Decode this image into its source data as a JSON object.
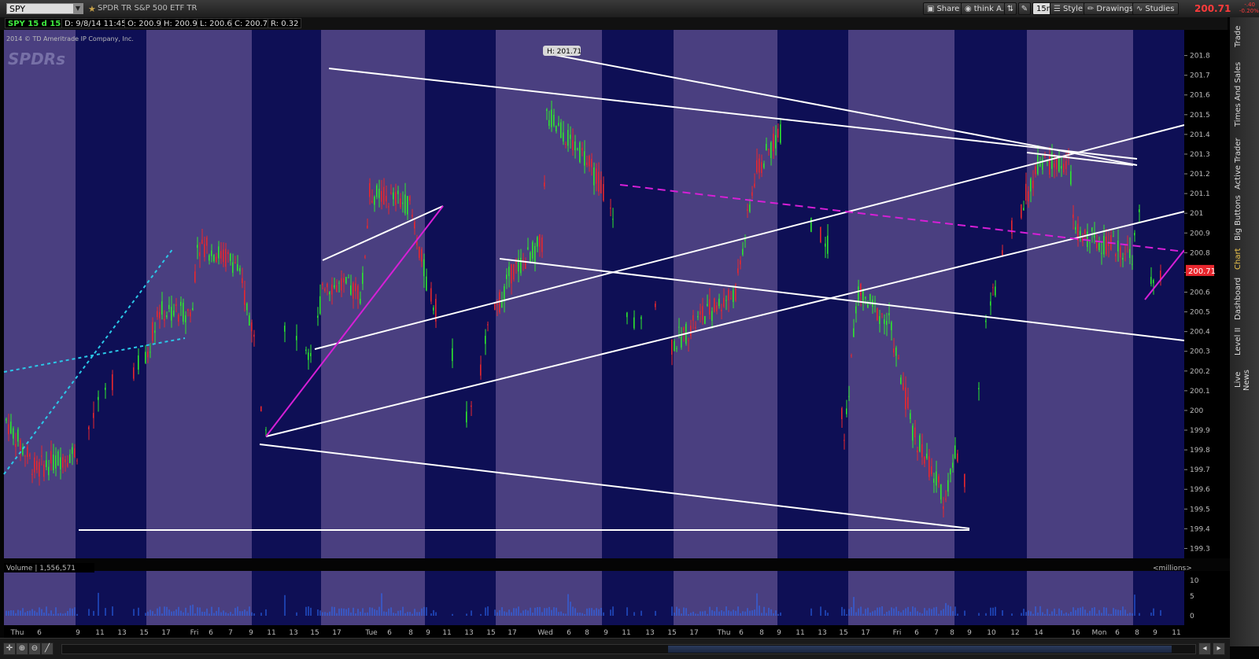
{
  "toolbar": {
    "symbol": "SPY",
    "description": "SPDR TR S&P 500 ETF TR",
    "buttons": [
      "Share",
      "think A.I.",
      "15m",
      "Style",
      "Drawings",
      "Studies"
    ],
    "last_price": "200.71",
    "change_top": "-.40",
    "change_bottom": "-0.20%"
  },
  "info_bar": {
    "chart_label": "SPY 15 d 15m",
    "date": "D: 9/8/14 11:45 AM",
    "open": "O: 200.91",
    "high": "H: 200.95",
    "low": "L: 200.63",
    "close": "C: 200.71",
    "range": "R: 0.32"
  },
  "copyright": "2014 © TD Ameritrade IP Company, Inc.",
  "watermark": "SPDRs",
  "right_tabs": [
    "Trade",
    "Times And Sales",
    "Active Trader",
    "Big Buttons",
    "Chart",
    "Dashboard",
    "Level II",
    "Live News"
  ],
  "volume_panel": {
    "label": "Volume",
    "value": "1,556,571",
    "units": "<millions>",
    "ticks": [
      "10",
      "5",
      "0"
    ]
  },
  "chart_data": {
    "type": "candlestick",
    "title": "SPY 15 d 15m",
    "ylim": [
      199.25,
      201.93
    ],
    "y_ticks": [
      "201.8",
      "201.7",
      "201.6",
      "201.5",
      "201.4",
      "201.3",
      "201.2",
      "201.1",
      "201",
      "200.9",
      "200.8",
      "200.7",
      "200.6",
      "200.5",
      "200.4",
      "200.3",
      "200.2",
      "200.1",
      "200",
      "199.9",
      "199.8",
      "199.7",
      "199.6",
      "199.5",
      "199.4",
      "199.3"
    ],
    "x_ticks": [
      "Thu",
      "6",
      "9",
      "11",
      "13",
      "15",
      "17",
      "Fri",
      "6",
      "7",
      "9",
      "11",
      "13",
      "15",
      "17",
      "Tue",
      "6",
      "8",
      "9",
      "11",
      "13",
      "15",
      "17",
      "Wed",
      "6",
      "8",
      "9",
      "11",
      "13",
      "15",
      "17",
      "Thu",
      "6",
      "8",
      "9",
      "11",
      "13",
      "15",
      "17",
      "Fri",
      "6",
      "7",
      "8",
      "9",
      "10",
      "12",
      "14",
      "16",
      "Mon",
      "6",
      "8",
      "9",
      "11",
      "13"
    ],
    "high_label": "H: 201.71",
    "last_price_tag": "200.71",
    "colors": {
      "up": "#2ee82e",
      "down": "#e8272e",
      "session_band": "#4a3f80",
      "off_band": "#0e0f55",
      "trendline": "#ffffff",
      "magenta": "#d61fd6",
      "cyan": "#2bc8e8"
    }
  }
}
